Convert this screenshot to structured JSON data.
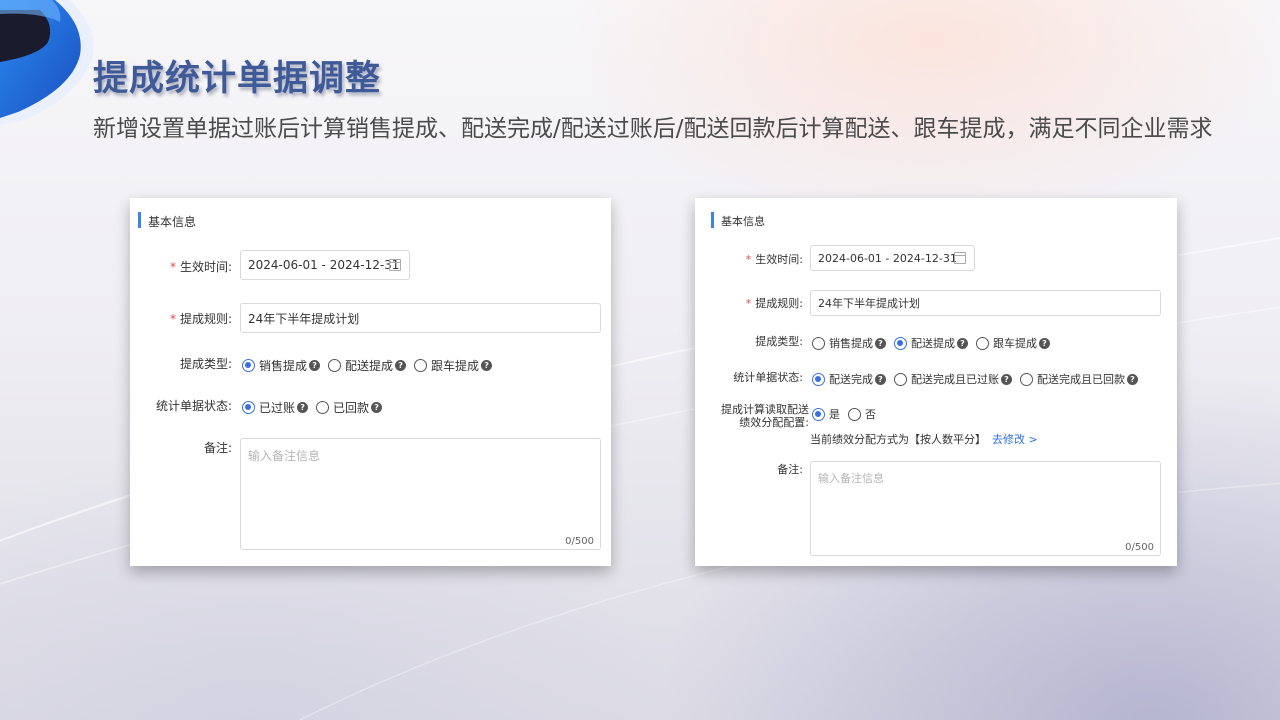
{
  "slide": {
    "title": "提成统计单据调整",
    "subtitle": "新增设置单据过账后计算销售提成、配送完成/配送过账后/配送回款后计算配送、跟车提成，满足不同企业需求"
  },
  "left_form": {
    "section_title": "基本信息",
    "effective_time": {
      "label": "生效时间:",
      "value": "2024-06-01 - 2024-12-31"
    },
    "rule": {
      "label": "提成规则:",
      "value": "24年下半年提成计划"
    },
    "type": {
      "label": "提成类型:",
      "options": [
        {
          "label": "销售提成",
          "selected": true
        },
        {
          "label": "配送提成",
          "selected": false
        },
        {
          "label": "跟车提成",
          "selected": false
        }
      ]
    },
    "status": {
      "label": "统计单据状态:",
      "options": [
        {
          "label": "已过账",
          "selected": true
        },
        {
          "label": "已回款",
          "selected": false
        }
      ]
    },
    "remark": {
      "label": "备注:",
      "placeholder": "输入备注信息",
      "counter": "0/500"
    }
  },
  "right_form": {
    "section_title": "基本信息",
    "effective_time": {
      "label": "生效时间:",
      "value": "2024-06-01 - 2024-12-31"
    },
    "rule": {
      "label": "提成规则:",
      "value": "24年下半年提成计划"
    },
    "type": {
      "label": "提成类型:",
      "options": [
        {
          "label": "销售提成",
          "selected": false
        },
        {
          "label": "配送提成",
          "selected": true
        },
        {
          "label": "跟车提成",
          "selected": false
        }
      ]
    },
    "status": {
      "label": "统计单据状态:",
      "options": [
        {
          "label": "配送完成",
          "selected": true
        },
        {
          "label": "配送完成且已过账",
          "selected": false
        },
        {
          "label": "配送完成且已回款",
          "selected": false
        }
      ]
    },
    "read_config": {
      "label_line1": "提成计算读取配送",
      "label_line2": "绩效分配配置:",
      "options": [
        {
          "label": "是",
          "selected": true
        },
        {
          "label": "否",
          "selected": false
        }
      ],
      "note": "当前绩效分配方式为【按人数平分】",
      "link": "去修改 >"
    },
    "remark": {
      "label": "备注:",
      "placeholder": "输入备注信息",
      "counter": "0/500"
    }
  },
  "icons": {
    "help": "question-circle-icon",
    "calendar": "calendar-icon"
  }
}
